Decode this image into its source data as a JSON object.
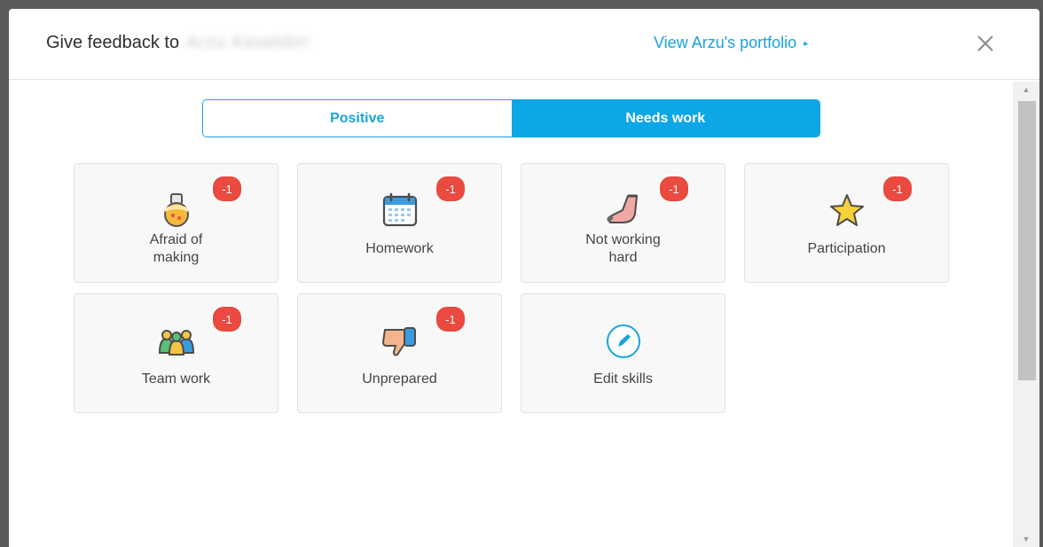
{
  "header": {
    "title": "Give feedback to",
    "student_name": "Arzu Keseldirr",
    "portfolio_link": "View Arzu's portfolio",
    "portfolio_arrow": "▸"
  },
  "tabs": {
    "positive": "Positive",
    "needs_work": "Needs work",
    "active": "needs_work"
  },
  "skills": [
    {
      "label_line1": "Afraid of",
      "label_line2": "making",
      "points": "-1",
      "icon": "flask-icon"
    },
    {
      "label_line1": "Homework",
      "points": "-1",
      "icon": "calendar-icon"
    },
    {
      "label_line1": "Not working",
      "label_line2": "hard",
      "points": "-1",
      "icon": "sock-foot-icon"
    },
    {
      "label_line1": "Participation",
      "points": "-1",
      "icon": "star-icon"
    },
    {
      "label_line1": "Team work",
      "points": "-1",
      "icon": "team-people-icon"
    },
    {
      "label_line1": "Unprepared",
      "points": "-1",
      "icon": "thumbs-down-icon"
    },
    {
      "label_line1": "Edit skills",
      "icon": "pencil-icon"
    }
  ],
  "colors": {
    "accent": "#17a3dd",
    "badge": "#ea4a3f"
  }
}
